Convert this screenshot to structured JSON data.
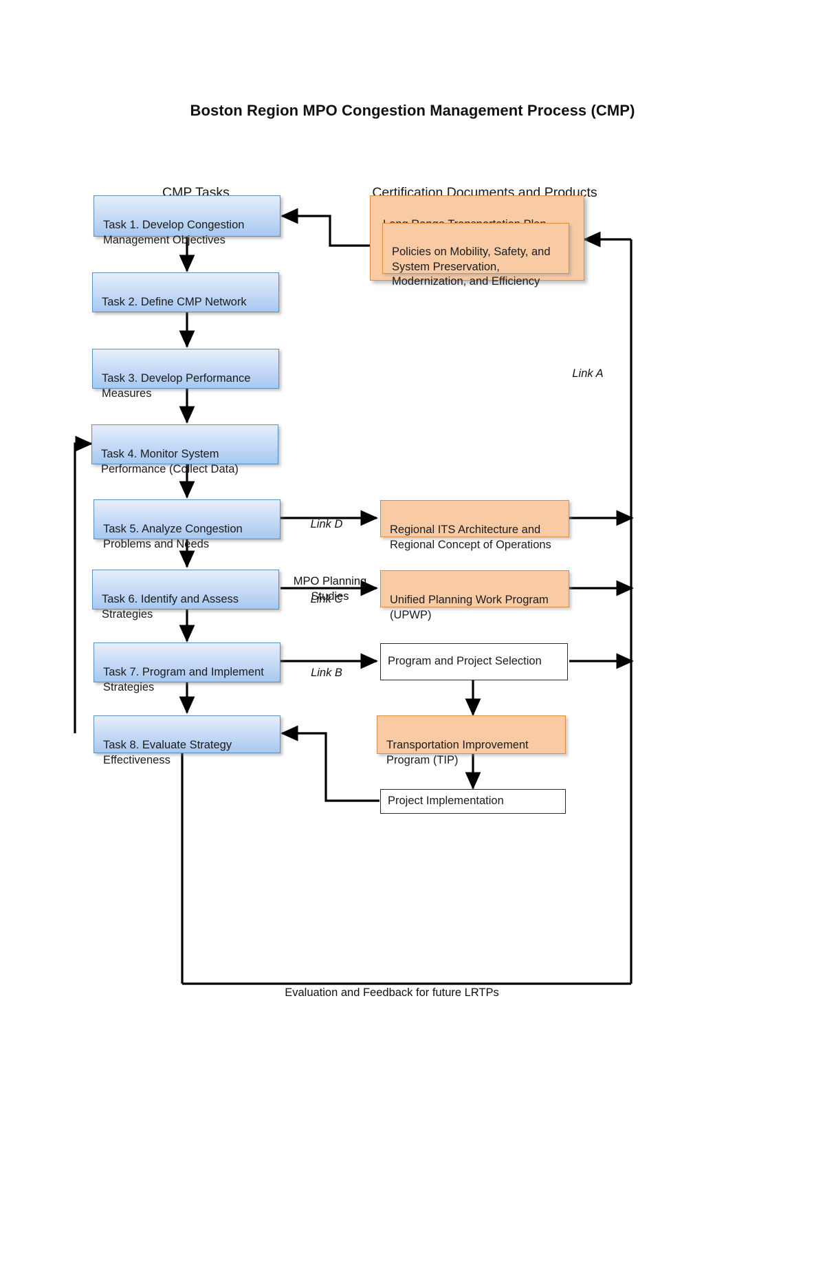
{
  "title": "Boston Region MPO Congestion Management Process (CMP)",
  "columns": {
    "left_header": "CMP Tasks",
    "right_header": "Certification Documents and\nProducts"
  },
  "tasks": [
    {
      "id": "task1",
      "label": "Task 1. Develop Congestion\nManagement Objectives"
    },
    {
      "id": "task2",
      "label": "Task 2. Define CMP Network"
    },
    {
      "id": "task3",
      "label": "Task  3. Develop Performance\nMeasures"
    },
    {
      "id": "task4",
      "label": "Task  4. Monitor System\nPerformance (Collect Data)"
    },
    {
      "id": "task5",
      "label": "Task 5. Analyze Congestion\nProblems and Needs"
    },
    {
      "id": "task6",
      "label": "Task 6. Identify and Assess\nStrategies"
    },
    {
      "id": "task7",
      "label": "Task 7. Program and Implement\nStrategies"
    },
    {
      "id": "task8",
      "label": "Task 8. Evaluate Strategy\nEffectiveness"
    }
  ],
  "documents": [
    {
      "id": "lrtp",
      "label": "Long Range Transportation Plan (LRTP)"
    },
    {
      "id": "policies",
      "label": "Policies on Mobility, Safety, and\nSystem Preservation,\nModernization, and Efficiency"
    },
    {
      "id": "its",
      "label": "Regional ITS Architecture and\nRegional Concept of Operations"
    },
    {
      "id": "upwp",
      "label": "Unified Planning Work Program\n(UPWP)"
    },
    {
      "id": "selection",
      "label": "Program and Project Selection"
    },
    {
      "id": "tip",
      "label": "Transportation Improvement\nProgram (TIP)"
    },
    {
      "id": "implementation",
      "label": "Project Implementation"
    }
  ],
  "edge_labels": {
    "link_a": "Link A",
    "link_b": "Link B",
    "link_c": "Link C",
    "link_d": "Link D",
    "mpo_planning_studies": "MPO Planning\nStudies",
    "footer": "Evaluation and Feedback for future LRTPs"
  },
  "colors": {
    "task_fill": "#cfe0f8",
    "task_border": "#5a8fc4",
    "doc_fill": "#f9cba4",
    "doc_border": "#e08a3c",
    "plain_fill": "#ffffff",
    "plain_border": "#2b2b2b",
    "edge_stroke": "#000000"
  }
}
